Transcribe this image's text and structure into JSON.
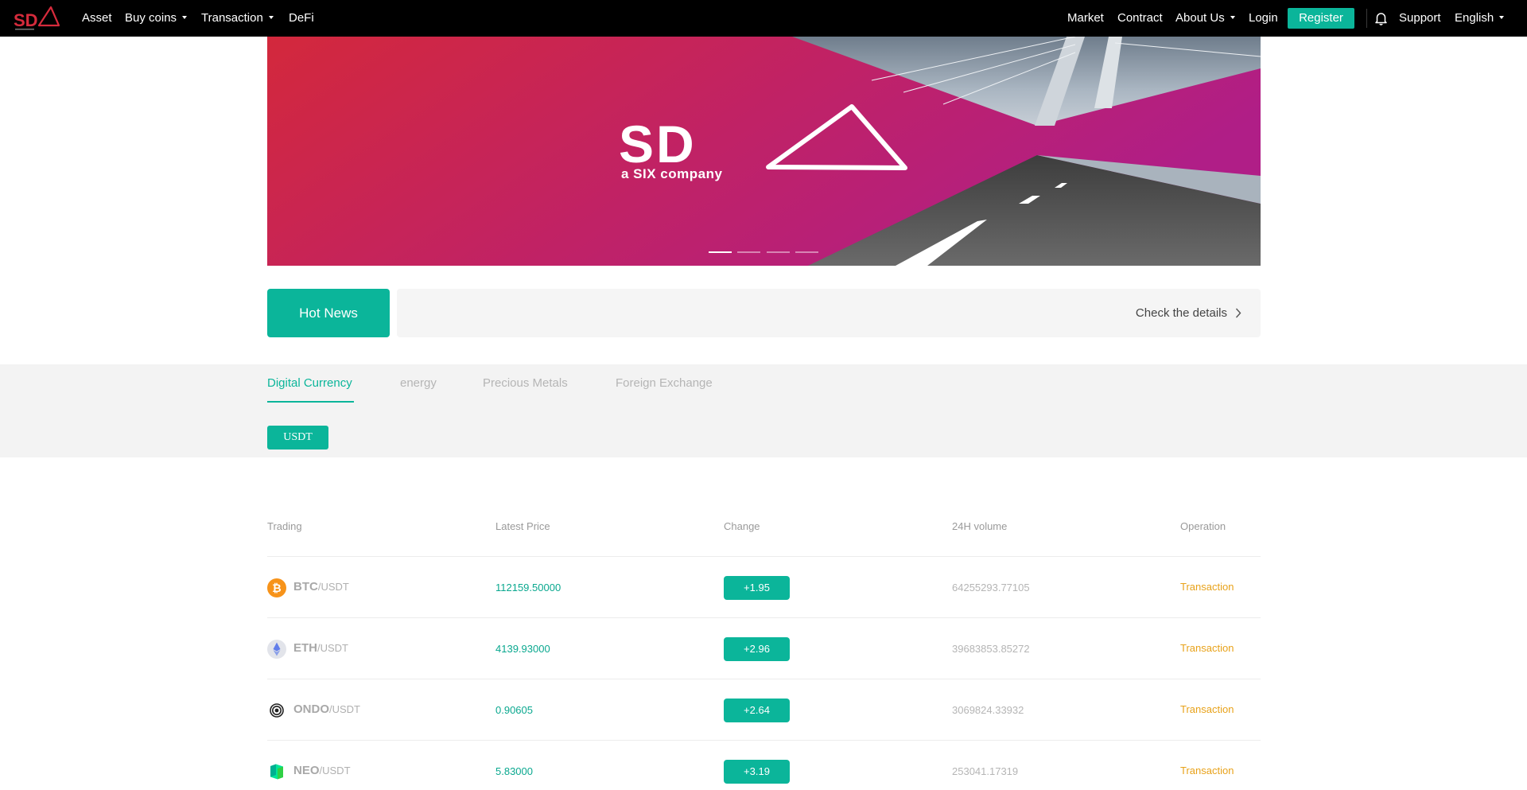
{
  "colors": {
    "accent": "#0bb59a",
    "nav_bg": "#000000",
    "banner_red": "#d3283c",
    "banner_magenta": "#b41e87",
    "operation": "#e8a21a"
  },
  "nav": {
    "logo_icon": "sda-logo-icon",
    "left": [
      {
        "label": "Asset"
      },
      {
        "label": "Buy coins"
      },
      {
        "label": "Transaction"
      },
      {
        "label": "DeFi"
      }
    ],
    "right": {
      "market": "Market",
      "contract": "Contract",
      "about": "About Us",
      "login": "Login",
      "register": "Register",
      "bell_icon": "bell-icon",
      "support": "Support",
      "language": "English"
    }
  },
  "banner": {
    "brand": "SD",
    "tagline": "a SIX company",
    "slides": 4,
    "active_slide": 1
  },
  "news": {
    "hot_label": "Hot News",
    "details_label": "Check the details"
  },
  "categories": {
    "tabs": [
      "Digital Currency",
      "energy",
      "Precious Metals",
      "Foreign Exchange"
    ],
    "active": "Digital Currency",
    "quote_chip": "USDT"
  },
  "market": {
    "headers": [
      "Trading",
      "Latest Price",
      "Change",
      "24H volume",
      "Operation"
    ],
    "rows": [
      {
        "base": "BTC",
        "quote": "/USDT",
        "icon": "btc-icon",
        "price": "112159.50000",
        "change": "+1.95",
        "volume": "64255293.77105",
        "op": "Transaction"
      },
      {
        "base": "ETH",
        "quote": "/USDT",
        "icon": "eth-icon",
        "price": "4139.93000",
        "change": "+2.96",
        "volume": "39683853.85272",
        "op": "Transaction"
      },
      {
        "base": "ONDO",
        "quote": "/USDT",
        "icon": "ondo-icon",
        "price": "0.90605",
        "change": "+2.64",
        "volume": "3069824.33932",
        "op": "Transaction"
      },
      {
        "base": "NEO",
        "quote": "/USDT",
        "icon": "neo-icon",
        "price": "5.83000",
        "change": "+3.19",
        "volume": "253041.17319",
        "op": "Transaction"
      }
    ]
  }
}
